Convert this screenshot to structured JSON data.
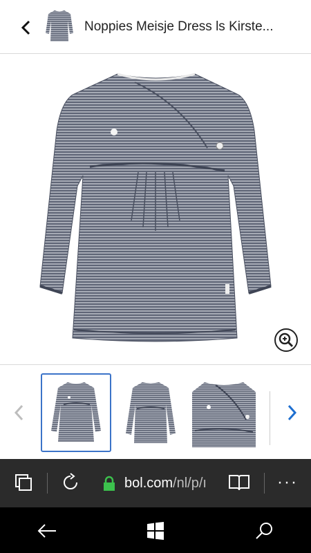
{
  "header": {
    "back_icon": "chevron-left-icon",
    "title": "Noppies Meisje Dress ls Kirste..."
  },
  "product": {
    "zoom_icon": "magnifier-zoom-icon",
    "colors": {
      "fabric": "#5d6373",
      "stripe": "#dfe2e8",
      "placket_button": "#f0f0f0"
    }
  },
  "thumbnails": {
    "prev_icon": "chevron-left-icon",
    "next_icon": "chevron-right-icon",
    "items": [
      {
        "name": "front-view",
        "selected": true
      },
      {
        "name": "back-view",
        "selected": false
      },
      {
        "name": "detail-view",
        "selected": false
      }
    ],
    "selected_color": "#3b73c8"
  },
  "browser": {
    "tabs_icon": "tabs-icon",
    "refresh_icon": "refresh-icon",
    "lock_icon": "lock-icon",
    "url_host": "bol.com",
    "url_path": "/nl/p/ı",
    "reading_icon": "reading-view-icon",
    "more_label": "···"
  },
  "system_nav": {
    "back_icon": "back-arrow-icon",
    "home_icon": "windows-logo-icon",
    "search_icon": "search-icon"
  }
}
